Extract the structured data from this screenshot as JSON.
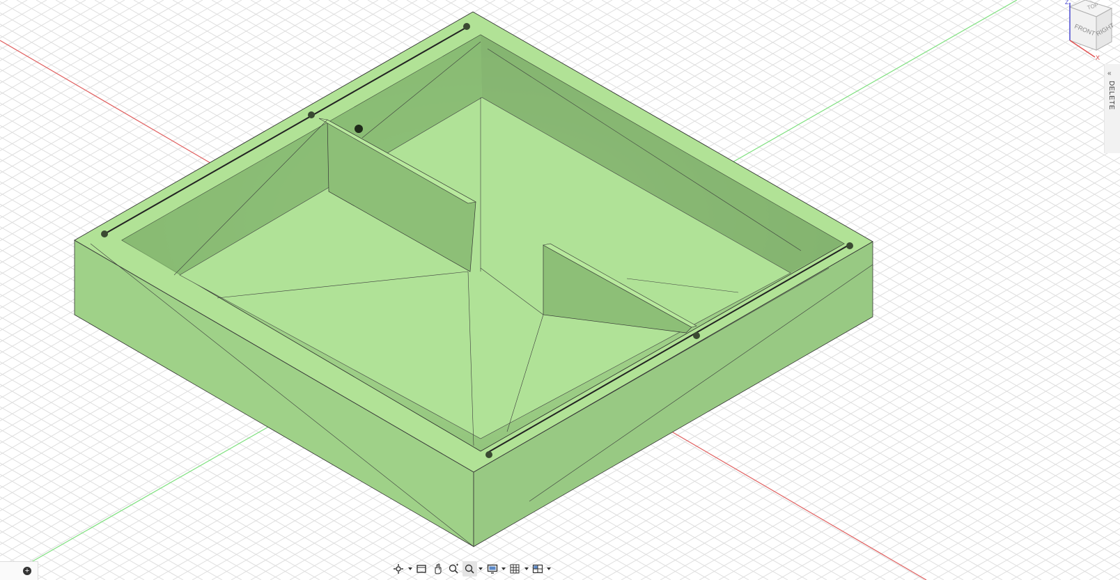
{
  "app": {
    "viewport": "3d-model-viewport"
  },
  "viewcube": {
    "top": "TOP",
    "front": "FRONT",
    "right": "RIGHT",
    "axis_z": "Z",
    "axis_x": "X"
  },
  "side_panel": {
    "collapse_icon": "«",
    "label": "DELETE"
  },
  "mini_bar": {
    "add_icon": "+"
  },
  "nav_bar": {
    "icons": [
      "orbit-icon",
      "look-at-icon",
      "pan-icon",
      "zoom-icon",
      "fit-icon",
      "display-settings-icon",
      "grid-settings-icon",
      "viewports-icon"
    ]
  },
  "colors": {
    "model_face": "#a4d78c",
    "model_top": "#b6e69b",
    "model_shadow": "#6e9e5a",
    "axis_red": "#e05050",
    "axis_green": "#60d060",
    "grid": "#dcdcdc"
  }
}
